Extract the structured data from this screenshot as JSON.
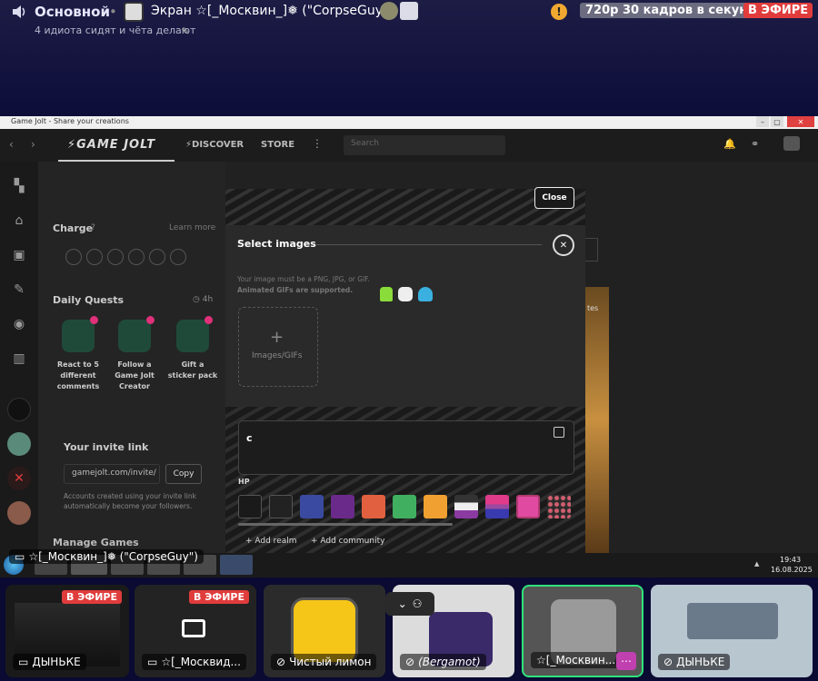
{
  "discord": {
    "channel": "Основной",
    "separator": "•",
    "screen_title": "Экран ☆[_Москвин_]❅ (\"CorpseGuy\")",
    "topic": "4 идиота сидят и чёта делают",
    "stream_quality": "720p 30 кадров в секунду",
    "live_badge": "В ЭФИРЕ",
    "warn": "!"
  },
  "window": {
    "title": "Game Jolt - Share your creations",
    "controls": [
      "–",
      "▢",
      "✕"
    ]
  },
  "gamejolt": {
    "logo": "GAME JOLT",
    "nav": [
      "DISCOVER",
      "STORE"
    ],
    "search_placeholder": "Search",
    "charge_title": "Charge",
    "charge_learn": "Learn more",
    "quests_title": "Daily Quests",
    "quests_timer": "4h",
    "quests": [
      {
        "label": "React to 5 different comments"
      },
      {
        "label": "Follow a Game Jolt Creator"
      },
      {
        "label": "Gift a sticker pack"
      }
    ],
    "invite_title": "Your invite link",
    "invite_url": "gamejolt.com/invite/",
    "invite_copy": "Copy",
    "invite_note": "Accounts created using your invite link automatically become your followers.",
    "manage_games": "Manage Games",
    "right_fragment": "tes"
  },
  "modal": {
    "close_top": "Close",
    "title": "Select images",
    "close_icon": "✕",
    "hint1": "Your image must be a PNG, JPG, or GIF.",
    "hint2": "Animated GIFs are supported.",
    "upload_plus": "+",
    "upload_label": "Images/GIFs",
    "text_value": "c",
    "hp_label": "HP",
    "add_realm": "+ Add realm",
    "add_community": "+ Add community"
  },
  "taskbar": {
    "window_label": "☆[_Москвин_]❅ (\"CorpseGuy\")",
    "time": "19:43",
    "date": "16.08.2025",
    "tray": "▲"
  },
  "participants": [
    {
      "name": "ДЫНЬКЕ",
      "live": "В ЭФИРЕ",
      "bg": "#1a1a1a"
    },
    {
      "name": "☆[_Москвид...",
      "live": "В ЭФИРЕ",
      "bg": "#232323"
    },
    {
      "name": "Чистый лимон",
      "live": "",
      "bg": "#2b2b2b"
    },
    {
      "name": "(Bergamot)",
      "live": "",
      "bg": "#dcdcdc"
    },
    {
      "name": "☆[_Москвин...",
      "live": "",
      "bg": "#555555"
    },
    {
      "name": "ДЫНЬКЕ",
      "live": "",
      "bg": "#b8c6d0"
    }
  ],
  "colors": {
    "accent": "#2fe37a",
    "live": "#e03c3c",
    "discord_bg": "#0a0a32"
  }
}
